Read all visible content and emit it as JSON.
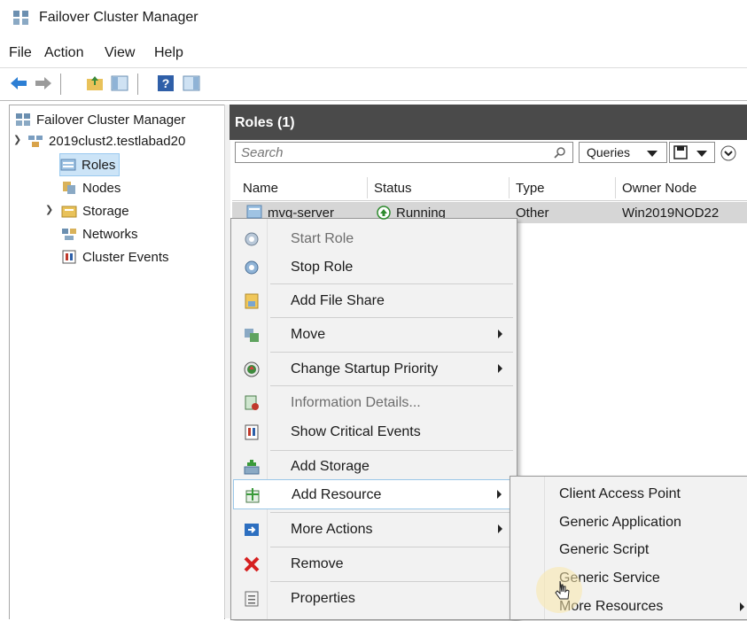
{
  "window": {
    "title": "Failover Cluster Manager",
    "app_icon": "cluster-manager-icon"
  },
  "menu": [
    "File",
    "Action",
    "View",
    "Help"
  ],
  "toolbar": {
    "buttons": [
      "back-arrow-icon",
      "forward-arrow-icon",
      "up-folder-icon",
      "show-hide-tree-icon",
      "help-icon",
      "show-hide-action-pane-icon"
    ]
  },
  "tree": {
    "root": "Failover Cluster Manager",
    "cluster": "2019clust2.testlabad20",
    "children": [
      "Roles",
      "Nodes",
      "Storage",
      "Networks",
      "Cluster Events"
    ],
    "selected": "Roles"
  },
  "roles_pane": {
    "title": "Roles (1)",
    "search_placeholder": "Search",
    "queries_label": "Queries",
    "columns": [
      "Name",
      "Status",
      "Type",
      "Owner Node"
    ],
    "rows": [
      {
        "name": "mvg-server",
        "status": "Running",
        "type": "Other",
        "owner": "Win2019NOD22"
      }
    ]
  },
  "context_menu": {
    "items": [
      {
        "label": "Start Role",
        "icon": "start-role-icon",
        "disabled": true
      },
      {
        "label": "Stop Role",
        "icon": "stop-role-icon"
      },
      {
        "label": "Add File Share",
        "icon": "file-share-icon"
      },
      {
        "label": "Move",
        "icon": "move-icon",
        "submenu": true
      },
      {
        "label": "Change Startup Priority",
        "icon": "priority-icon",
        "submenu": true
      },
      {
        "label": "Information Details...",
        "icon": "information-icon",
        "disabled": true
      },
      {
        "label": "Show Critical Events",
        "icon": "critical-events-icon"
      },
      {
        "label": "Add Storage",
        "icon": "add-storage-icon"
      },
      {
        "label": "Add Resource",
        "icon": "add-resource-icon",
        "submenu": true,
        "highlighted": true
      },
      {
        "label": "More Actions",
        "icon": "more-actions-icon",
        "submenu": true
      },
      {
        "label": "Remove",
        "icon": "remove-icon"
      },
      {
        "label": "Properties",
        "icon": "properties-icon"
      }
    ]
  },
  "submenu": {
    "items": [
      "Client Access Point",
      "Generic Application",
      "Generic Script",
      "Generic Service",
      "More Resources"
    ]
  }
}
